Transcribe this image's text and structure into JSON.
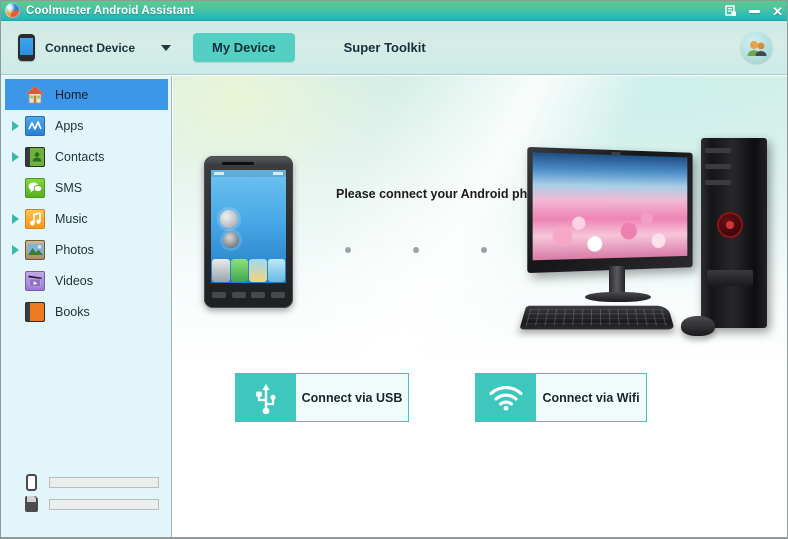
{
  "window": {
    "title": "Coolmuster Android Assistant",
    "app_icon": "globe-icon",
    "controls": [
      {
        "name": "restore-window-button",
        "glyph": "restore-icon"
      },
      {
        "name": "minimize-button",
        "glyph": "minimize-icon"
      },
      {
        "name": "close-button",
        "glyph": "✕"
      }
    ]
  },
  "toolbar": {
    "device_icon": "phone-icon",
    "device_label": "Connect Device",
    "dropdown_icon": "chevron-down-icon",
    "tabs": [
      {
        "label": "My Device",
        "active": true
      },
      {
        "label": "Super Toolkit",
        "active": false
      }
    ],
    "avatar_icon": "users-icon"
  },
  "sidebar": {
    "items": [
      {
        "label": "Home",
        "icon": "home-icon",
        "expandable": false,
        "selected": true
      },
      {
        "label": "Apps",
        "icon": "apps-icon",
        "expandable": true,
        "selected": false
      },
      {
        "label": "Contacts",
        "icon": "contacts-icon",
        "expandable": true,
        "selected": false
      },
      {
        "label": "SMS",
        "icon": "sms-icon",
        "expandable": false,
        "selected": false
      },
      {
        "label": "Music",
        "icon": "music-icon",
        "expandable": true,
        "selected": false
      },
      {
        "label": "Photos",
        "icon": "photos-icon",
        "expandable": true,
        "selected": false
      },
      {
        "label": "Videos",
        "icon": "videos-icon",
        "expandable": false,
        "selected": false
      },
      {
        "label": "Books",
        "icon": "books-icon",
        "expandable": false,
        "selected": false
      }
    ],
    "storage": [
      {
        "icon": "phone-storage-icon",
        "percent": 0
      },
      {
        "icon": "sd-card-icon",
        "percent": 0
      }
    ]
  },
  "main": {
    "message": "Please connect your Android phone.",
    "dots_count": 4,
    "phone_illustration": "android-phone-illustration",
    "computer_illustration": "desktop-computer-illustration",
    "buttons": [
      {
        "label": "Connect via USB",
        "icon": "usb-icon"
      },
      {
        "label": "Connect via Wifi",
        "icon": "wifi-icon"
      }
    ]
  },
  "colors": {
    "titlebar_green": "#5cc98e",
    "titlebar_teal": "#1fb6b6",
    "toolbar_mint": "#d6ece6",
    "accent_teal": "#3ec8bd",
    "tab_active": "#55cfc4",
    "sidebar_bg": "#e2f5fb",
    "selected_blue": "#3d97e8",
    "dot_gray": "#9aa2a8"
  }
}
